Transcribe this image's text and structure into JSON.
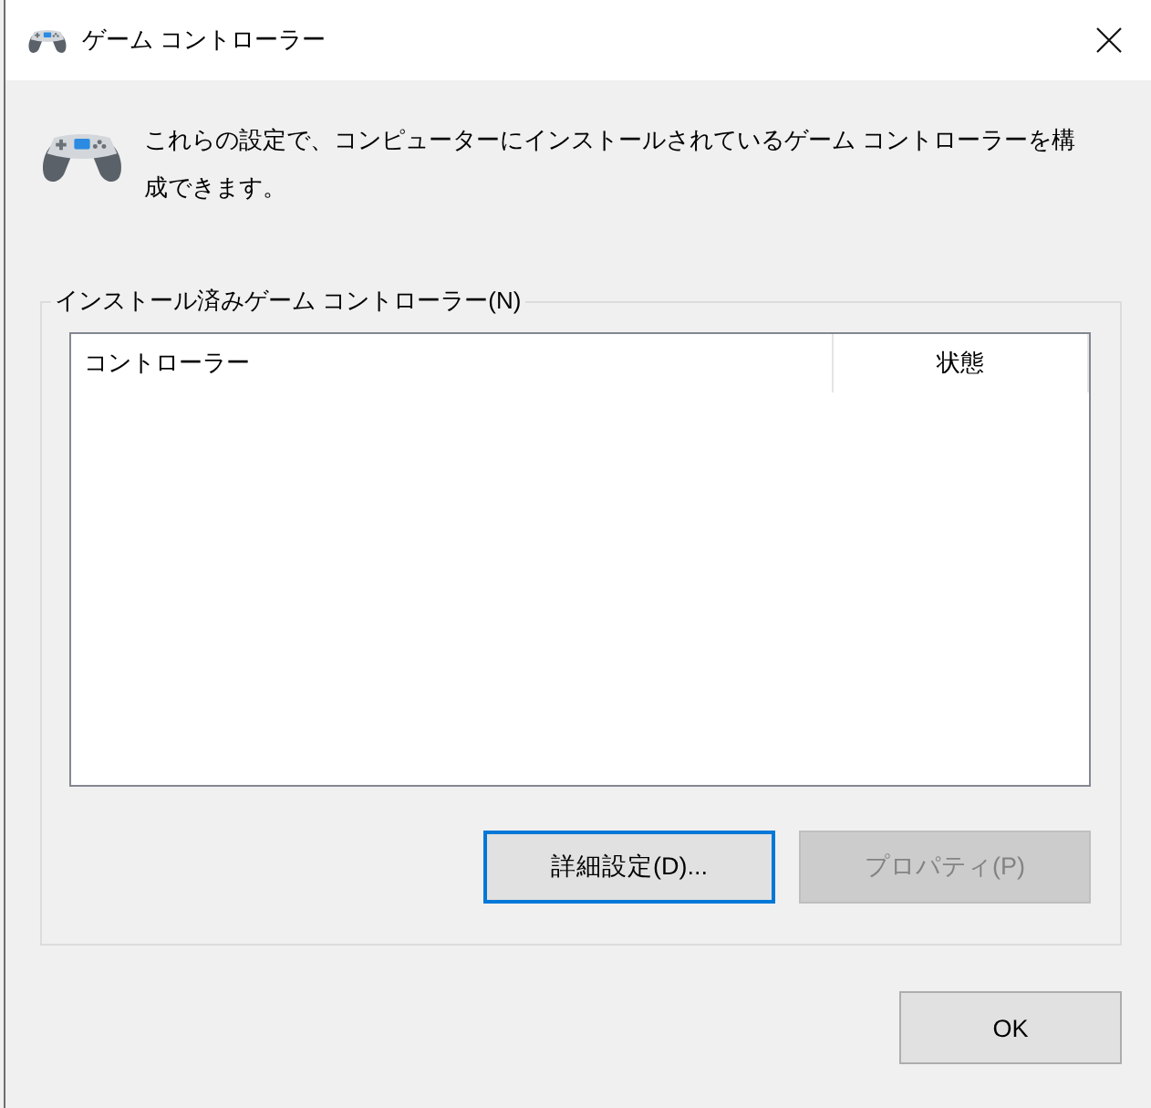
{
  "window": {
    "title": "ゲーム コントローラー"
  },
  "description": "これらの設定で、コンピューターにインストールされているゲーム コントローラーを構成できます。",
  "controllers_group": {
    "label": "インストール済みゲーム コントローラー(N)",
    "list": {
      "columns": [
        {
          "label": "コントローラー"
        },
        {
          "label": "状態"
        }
      ]
    },
    "buttons": [
      {
        "label": "詳細設定(D)...",
        "focused": true,
        "disabled": false
      },
      {
        "label": "プロパティ(P)",
        "focused": false,
        "disabled": true
      }
    ]
  },
  "footer_buttons": [
    {
      "label": "OK",
      "focused": false,
      "disabled": false
    }
  ]
}
